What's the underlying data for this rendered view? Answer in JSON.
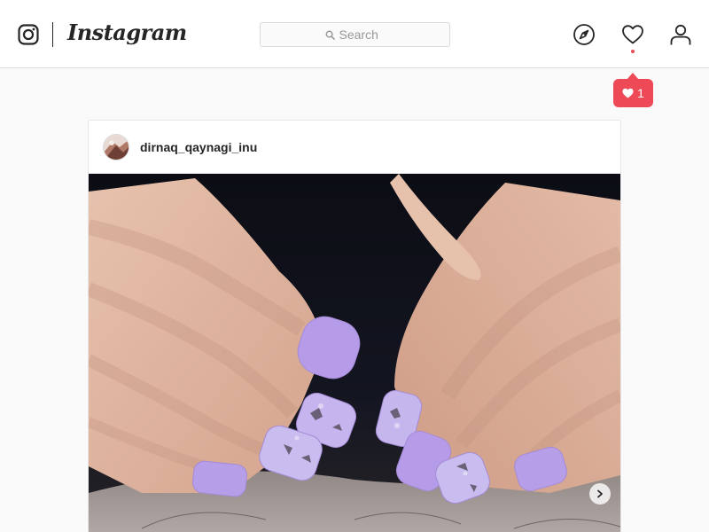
{
  "app": {
    "wordmark": "Instagram",
    "brand_color": "#262626",
    "accent_color": "#ed4956"
  },
  "header": {
    "logo_icon": "instagram-camera-icon",
    "search": {
      "placeholder": "Search",
      "icon": "search-icon"
    },
    "nav_icons": [
      "compass-icon",
      "heart-icon",
      "person-icon"
    ],
    "has_notification_dot": true
  },
  "activity_popup": {
    "icon": "heart-icon",
    "likes_count": "1"
  },
  "post": {
    "username": "dirnaq_qaynagi_inu",
    "avatar_icon": "avatar-photo",
    "image_subject": "photo-media",
    "carousel_next_icon": "chevron-right-icon"
  }
}
